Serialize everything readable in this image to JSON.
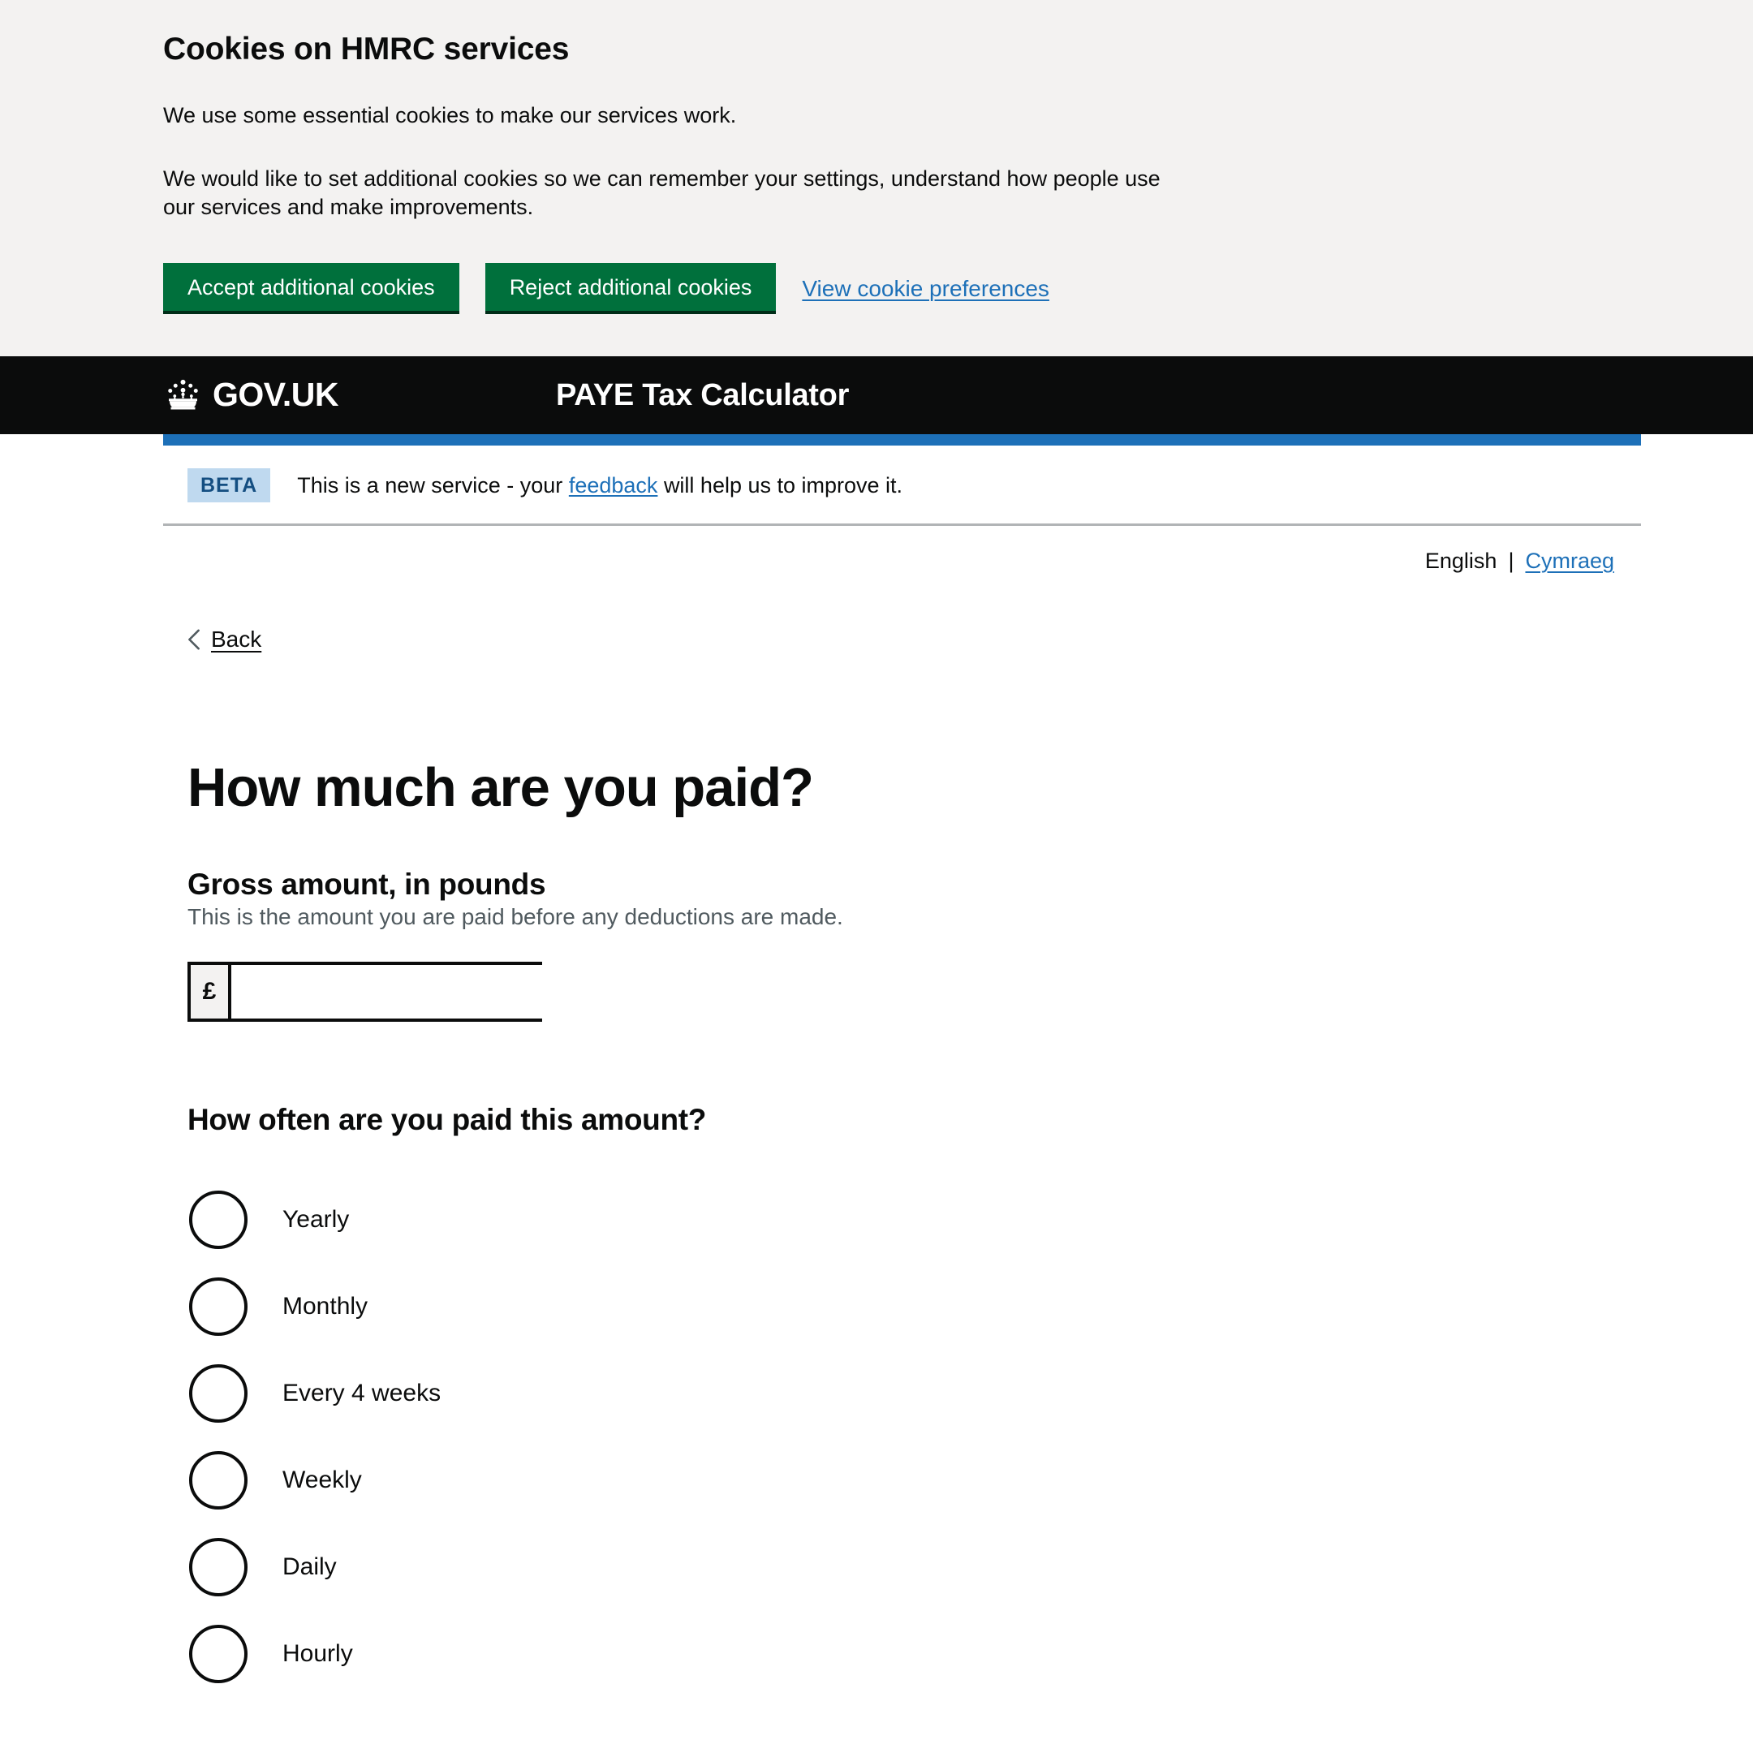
{
  "cookie_banner": {
    "title": "Cookies on HMRC services",
    "paragraph_1": "We use some essential cookies to make our services work.",
    "paragraph_2": "We would like to set additional cookies so we can remember your settings, understand how people use our services and make improvements.",
    "accept_label": "Accept additional cookies",
    "reject_label": "Reject additional cookies",
    "preferences_link": "View cookie preferences"
  },
  "header": {
    "logo_text": "GOV.UK",
    "service_name": "PAYE Tax Calculator"
  },
  "phase_banner": {
    "tag": "BETA",
    "text_before": "This is a new service - your",
    "link": "feedback",
    "text_after": "will help us to improve it."
  },
  "language": {
    "current": "English",
    "separator": "|",
    "alternative": "Cymraeg"
  },
  "back": {
    "label": "Back"
  },
  "main": {
    "heading": "How much are you paid?",
    "gross_amount": {
      "label": "Gross amount, in pounds",
      "hint": "This is the amount you are paid before any deductions are made.",
      "prefix": "£",
      "value": "",
      "placeholder": ""
    },
    "frequency": {
      "heading": "How often are you paid this amount?",
      "options": [
        {
          "label": "Yearly",
          "selected": false
        },
        {
          "label": "Monthly",
          "selected": false
        },
        {
          "label": "Every 4 weeks",
          "selected": false
        },
        {
          "label": "Weekly",
          "selected": false
        },
        {
          "label": "Daily",
          "selected": false
        },
        {
          "label": "Hourly",
          "selected": false
        }
      ]
    }
  },
  "colors": {
    "green_button": "#00703c",
    "link_blue": "#1d70b8",
    "header_black": "#0b0c0c",
    "banner_grey": "#f3f2f1",
    "beta_tag_bg": "#bfd9ef",
    "beta_tag_text": "#144e81",
    "hint_grey": "#505a5f"
  }
}
